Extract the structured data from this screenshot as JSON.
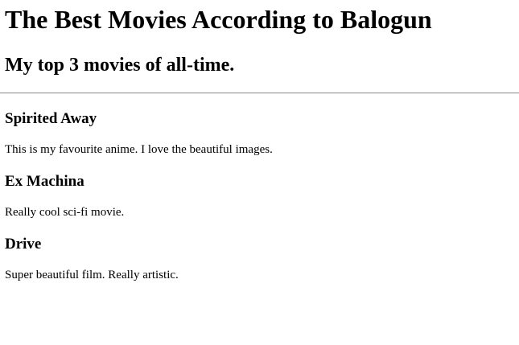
{
  "page": {
    "title": "The Best Movies According to Balogun",
    "subtitle": "My top 3 movies of all-time."
  },
  "movies": [
    {
      "title": "Spirited Away",
      "description": "This is my favourite anime. I love the beautiful images."
    },
    {
      "title": "Ex Machina",
      "description": "Really cool sci-fi movie."
    },
    {
      "title": "Drive",
      "description": "Super beautiful film. Really artistic."
    }
  ]
}
